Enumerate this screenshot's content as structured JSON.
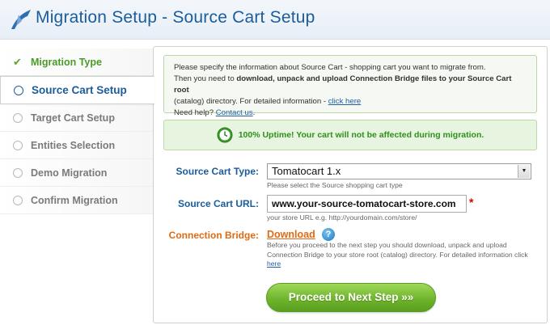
{
  "header": {
    "title": "Migration Setup - Source Cart Setup",
    "logo_icon": "migration-arrow-icon"
  },
  "sidebar": {
    "steps": [
      {
        "label": "Migration Type",
        "state": "done"
      },
      {
        "label": "Source Cart Setup",
        "state": "active"
      },
      {
        "label": "Target Cart Setup",
        "state": "pending"
      },
      {
        "label": "Entities Selection",
        "state": "pending"
      },
      {
        "label": "Demo Migration",
        "state": "pending"
      },
      {
        "label": "Confirm Migration",
        "state": "pending"
      }
    ]
  },
  "info": {
    "line1": "Please specify the information about Source Cart - shopping cart you want to migrate from.",
    "line2_pre": "Then you need to ",
    "line2_bold": "download, unpack and upload Connection Bridge files to your Source Cart root",
    "line3_pre": "(catalog) directory. For detailed information - ",
    "line3_link": "click here",
    "help_pre": "Need help? ",
    "help_link": "Contact us",
    "help_post": "."
  },
  "uptime": {
    "text": "100% Uptime! Your cart will not be affected during migration.",
    "icon": "clock-icon"
  },
  "form": {
    "cart_type_label": "Source Cart Type:",
    "cart_type_value": "Tomatocart 1.x",
    "cart_type_hint": "Please select the Source shopping cart type",
    "cart_url_label": "Source Cart URL:",
    "cart_url_value": "www.your-source-tomatocart-store.com",
    "required_mark": "*",
    "cart_url_hint": "your store URL e.g. http://yourdomain.com/store/",
    "bridge_label": "Connection Bridge:",
    "bridge_link": "Download",
    "bridge_help": "?",
    "bridge_desc_pre": "Before you proceed to the next step you should download, unpack and upload Connection Bridge to your store root (catalog) directory. For detailed information click ",
    "bridge_desc_link": "here"
  },
  "actions": {
    "proceed_label": "Proceed to Next Step »»"
  },
  "colors": {
    "accent": "#1b5c9a",
    "success": "#4a9a28",
    "orange": "#e06a12",
    "button_green": "#6fb52c"
  }
}
